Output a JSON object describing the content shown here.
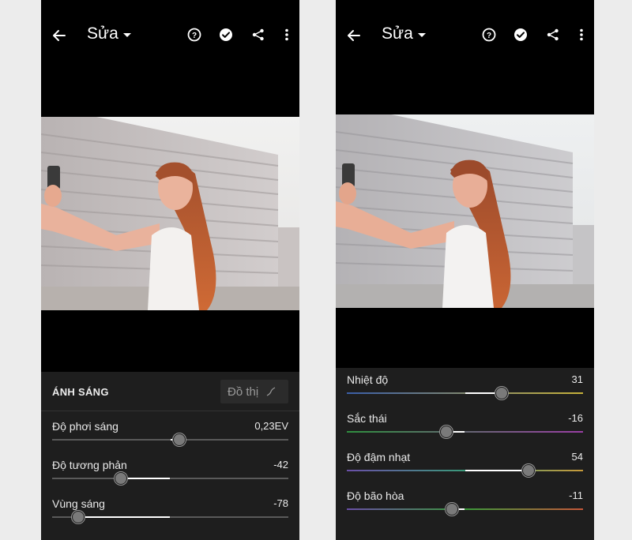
{
  "left_screen": {
    "title": "Sửa",
    "panel": {
      "heading": "ÁNH SÁNG",
      "graph_button": "Đồ thị"
    },
    "sliders": [
      {
        "label": "Độ phơi sáng",
        "value": "0,23EV",
        "position": 0.54,
        "fill_from": 0.5
      },
      {
        "label": "Độ tương phản",
        "value": "-42",
        "position": 0.29,
        "fill_from": 0.5
      },
      {
        "label": "Vùng sáng",
        "value": "-78",
        "position": 0.11,
        "fill_from": 0.5
      }
    ]
  },
  "right_screen": {
    "title": "Sửa",
    "sliders": [
      {
        "label": "Nhiệt độ",
        "value": "31",
        "position": 0.655,
        "fill_from": 0.5,
        "gradient": [
          "#3a5ea8",
          "#c7b23a"
        ]
      },
      {
        "label": "Sắc thái",
        "value": "-16",
        "position": 0.42,
        "fill_from": 0.5,
        "gradient": [
          "#2f8f3f",
          "#9a3fa5"
        ]
      },
      {
        "label": "Độ đậm nhạt",
        "value": "54",
        "position": 0.77,
        "fill_from": 0.5,
        "gradient": [
          "#6a4fa8",
          "#3a9a7a",
          "#c79a3a"
        ]
      },
      {
        "label": "Độ bão hòa",
        "value": "-11",
        "position": 0.445,
        "fill_from": 0.5,
        "gradient": [
          "#6a4fa8",
          "#3a9a3a",
          "#c7583a"
        ]
      }
    ]
  },
  "icons": [
    "back-arrow-icon",
    "caret-down-icon",
    "help-icon",
    "check-circle-icon",
    "share-icon",
    "more-vertical-icon",
    "graph-curve-icon"
  ]
}
